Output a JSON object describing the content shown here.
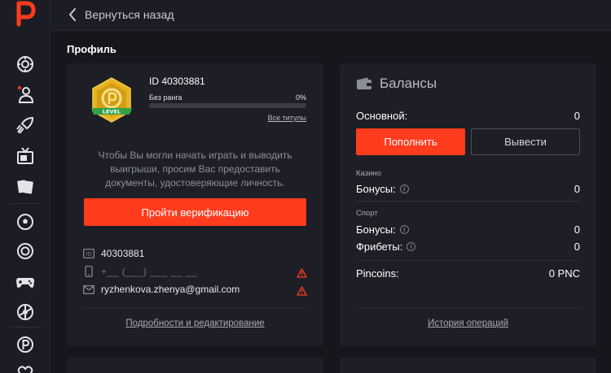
{
  "colors": {
    "accent": "#ff3c1e",
    "background": "#16171d",
    "card": "#1e1f26",
    "badge_gold": "#e8b21f",
    "badge_green": "#2fa24a"
  },
  "sidebar": {
    "logo": "P",
    "icons": [
      "casino-chip-icon",
      "live-dealer-icon",
      "rocket-icon",
      "tv-games-icon",
      "cards-icon",
      "football-icon",
      "target-icon",
      "gamepad-icon",
      "wheel-icon",
      "pincoin-icon",
      "heart-icon"
    ]
  },
  "topbar": {
    "back_label": "Вернуться назад"
  },
  "page": {
    "title": "Профиль"
  },
  "profile": {
    "badge_text": "LEVEL",
    "id_line": "ID 40303881",
    "rank": "Без ранга",
    "rank_percent": "0%",
    "rank_progress": 0,
    "all_titles": "Все титулы",
    "verify_text": "Чтобы Вы могли начать играть и выводить выигрыши, просим Вас предоставить документы, удостоверяющие личность.",
    "verify_button": "Пройти верификацию",
    "user_id": "40303881",
    "phone_mask": "+__ (___) ___ __ __",
    "email": "ryzhenkova.zhenya@gmail.com",
    "details_link": "Подробности и редактирование"
  },
  "balance": {
    "title": "Балансы",
    "main_label": "Основной:",
    "main_value": "0",
    "topup_button": "Пополнить",
    "withdraw_button": "Вывести",
    "casino_section": "Казино",
    "casino_bonus_label": "Бонусы:",
    "casino_bonus_value": "0",
    "sport_section": "Спорт",
    "sport_bonus_label": "Бонусы:",
    "sport_bonus_value": "0",
    "freebets_label": "Фрибеты:",
    "freebets_value": "0",
    "pincoins_label": "Pincoins:",
    "pincoins_value": "0 PNC",
    "history_link": "История операций"
  }
}
